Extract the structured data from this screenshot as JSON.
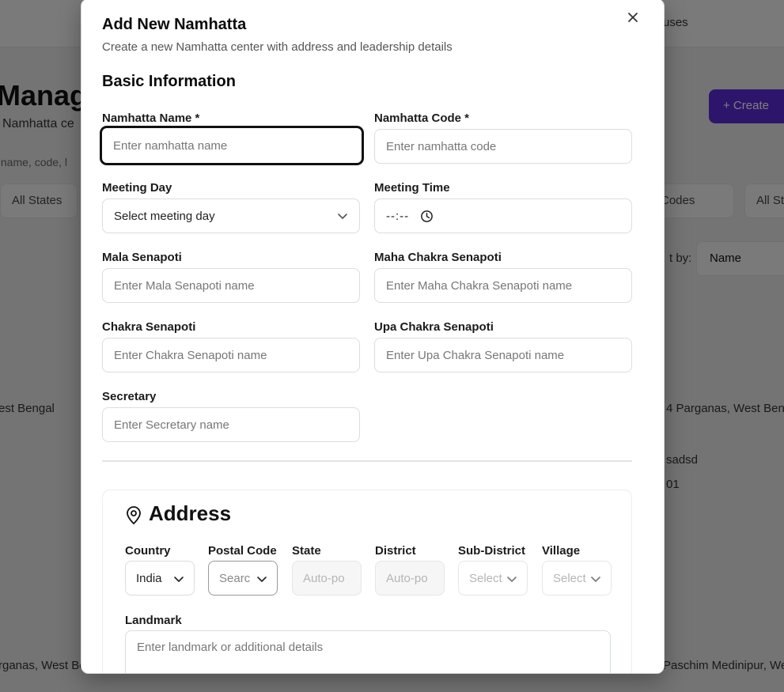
{
  "background": {
    "nav_text": "uses",
    "title": "Manag",
    "subtitle": "Namhatta ce",
    "search_text": "y name, code, l",
    "create_label": "+  Create",
    "filter_states": "All States",
    "filter_codes": "Codes",
    "filter_all_st": "All St",
    "sort_label": "t by:",
    "sort_value": "Name",
    "row1_left": "est Bengal",
    "row1_right": "4 Parganas, West Beng",
    "row2_right_a": "sadsd",
    "row2_right_b": "01",
    "row3_left": "rganas, West Be",
    "row3_right": "Paschim Medinipur, We"
  },
  "modal": {
    "title": "Add New Namhatta",
    "description": "Create a new Namhatta center with address and leadership details",
    "section_basic": "Basic Information",
    "fields": {
      "name_label": "Namhatta Name *",
      "name_placeholder": "Enter namhatta name",
      "code_label": "Namhatta Code *",
      "code_placeholder": "Enter namhatta code",
      "day_label": "Meeting Day",
      "day_value": "Select meeting day",
      "time_label": "Meeting Time",
      "time_value": "--:--",
      "mala_label": "Mala Senapoti",
      "mala_placeholder": "Enter Mala Senapoti name",
      "maha_label": "Maha Chakra Senapoti",
      "maha_placeholder": "Enter Maha Chakra Senapoti name",
      "chakra_label": "Chakra Senapoti",
      "chakra_placeholder": "Enter Chakra Senapoti name",
      "upa_label": "Upa Chakra Senapoti",
      "upa_placeholder": "Enter Upa Chakra Senapoti name",
      "secretary_label": "Secretary",
      "secretary_placeholder": "Enter Secretary name"
    },
    "address": {
      "title": "Address",
      "icon": "map-pin-icon",
      "country_label": "Country",
      "country_value": "India",
      "postal_label": "Postal Code",
      "postal_value": "Searc",
      "state_label": "State",
      "state_value": "Auto-po",
      "district_label": "District",
      "district_value": "Auto-po",
      "subdistrict_label": "Sub-District",
      "subdistrict_value": "Select",
      "village_label": "Village",
      "village_value": "Select",
      "landmark_label": "Landmark",
      "landmark_placeholder": "Enter landmark or additional details"
    }
  }
}
